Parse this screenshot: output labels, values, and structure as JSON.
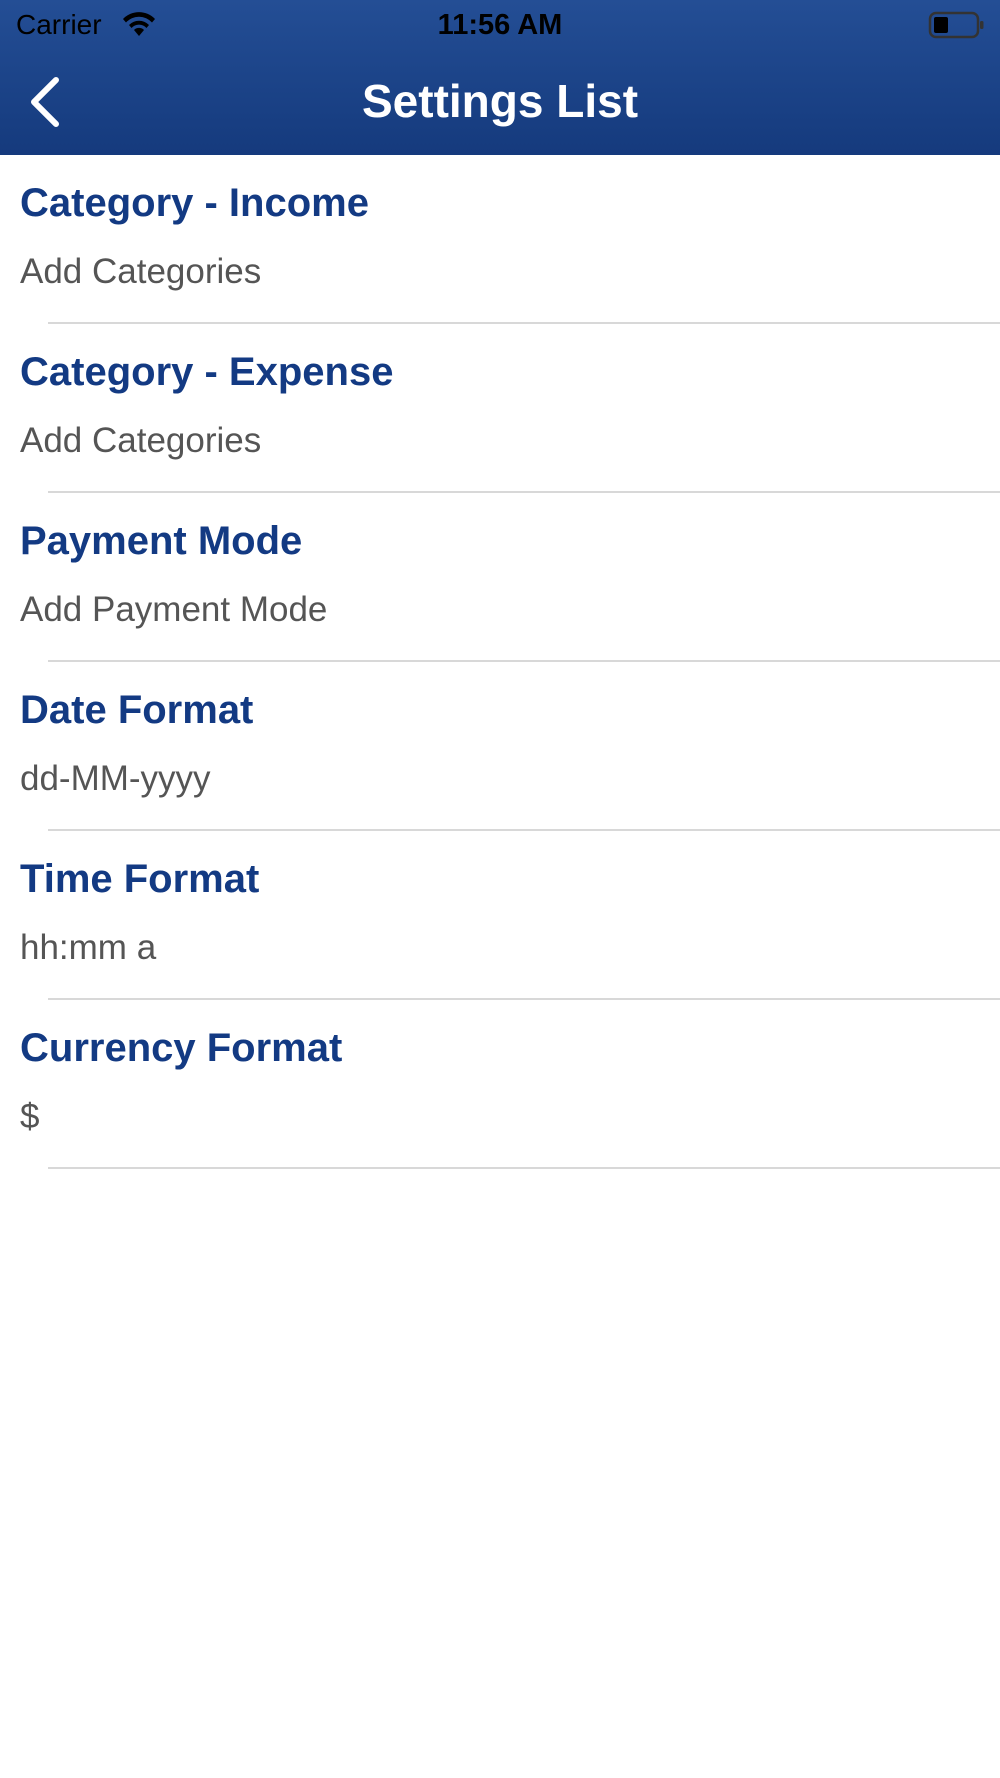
{
  "status_bar": {
    "carrier": "Carrier",
    "time": "11:56 AM",
    "wifi_icon": "wifi-icon",
    "battery_icon": "battery-icon"
  },
  "nav_bar": {
    "title": "Settings List",
    "back_icon": "chevron-left-icon",
    "background_color": "#1c4489"
  },
  "colors": {
    "title_text": "#133a83",
    "value_text": "#555555",
    "divider": "#d8d8d8"
  },
  "settings": [
    {
      "title": "Category - Income",
      "value": "Add Categories"
    },
    {
      "title": "Category - Expense",
      "value": "Add Categories"
    },
    {
      "title": "Payment Mode",
      "value": "Add Payment Mode"
    },
    {
      "title": "Date Format",
      "value": "dd-MM-yyyy"
    },
    {
      "title": "Time Format",
      "value": "hh:mm a"
    },
    {
      "title": "Currency Format",
      "value": "$"
    }
  ]
}
